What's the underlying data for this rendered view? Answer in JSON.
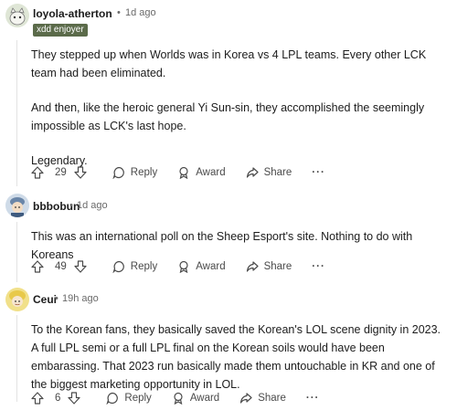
{
  "comments": [
    {
      "author": "loyola-atherton",
      "age": "1d ago",
      "flair": "xdd enjoyer",
      "paragraphs": [
        "They stepped up when Worlds was in Korea vs 4 LPL teams. Every other LCK team had been eliminated.",
        "And then, like the heroic general Yi Sun-sin, they accomplished the seemingly impossible as LCK's last hope.",
        "Legendary."
      ],
      "votes": "29",
      "reply": "Reply",
      "award": "Award",
      "share": "Share",
      "more": "···"
    },
    {
      "author": "bbbobun",
      "age": "1d ago",
      "paragraphs": [
        "This was an international poll on the Sheep Esport's site. Nothing to do with Koreans"
      ],
      "votes": "49",
      "reply": "Reply",
      "award": "Award",
      "share": "Share",
      "more": "···"
    },
    {
      "author": "Ceui",
      "age": "19h ago",
      "paragraphs": [
        "To the Korean fans, they basically saved the Korean's LOL scene dignity in 2023. A full LPL semi or a full LPL final on the Korean soils would have been embarassing. That 2023 run basically made them untouchable in KR and one of the biggest marketing opportunity in LOL."
      ],
      "votes": "6",
      "reply": "Reply",
      "award": "Award",
      "share": "Share",
      "more": "···"
    }
  ],
  "separator": "•",
  "colors": {
    "flair_bg": "#5b6b4a",
    "meta": "#6a6a6a",
    "action": "#4a4a4a"
  }
}
